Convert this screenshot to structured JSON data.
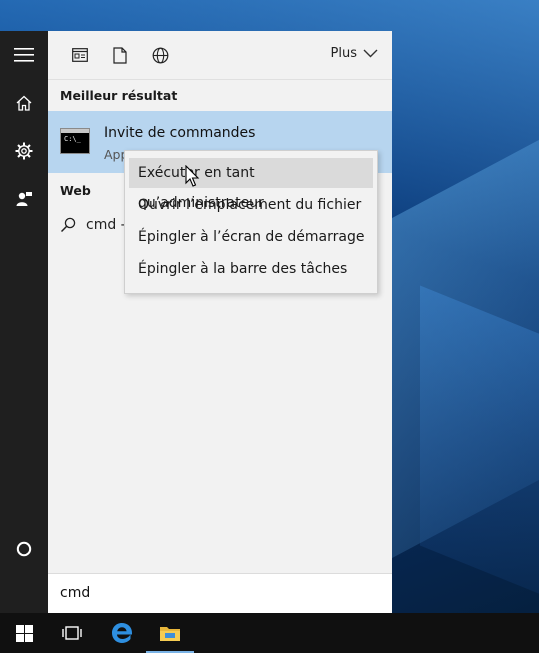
{
  "rail": {
    "icons": [
      "hamburger-icon",
      "home-icon",
      "settings-icon",
      "feedback-icon",
      "cortana-icon"
    ]
  },
  "panel": {
    "filters": [
      "apps-filter-icon",
      "documents-filter-icon",
      "web-filter-icon"
    ],
    "more_label": "Plus",
    "best_match_heading": "Meilleur résultat",
    "best_match": {
      "title": "Invite de commandes",
      "subtitle": "App"
    },
    "web_heading": "Web",
    "web_suggestion": "cmd -"
  },
  "context_menu": {
    "items": [
      "Exécuter en tant qu’administrateur",
      "Ouvrir l’emplacement du fichier",
      "Épingler à l’écran de démarrage",
      "Épingler à la barre des tâches"
    ],
    "hovered_index": 0
  },
  "search": {
    "value": "cmd"
  },
  "taskbar": {
    "icons": [
      "windows-start-icon",
      "task-view-icon",
      "edge-icon",
      "file-explorer-icon"
    ]
  },
  "colors": {
    "accent_highlight": "#b7d5ef",
    "rail_bg": "#1f1f1f",
    "taskbar_bg": "#101010"
  }
}
